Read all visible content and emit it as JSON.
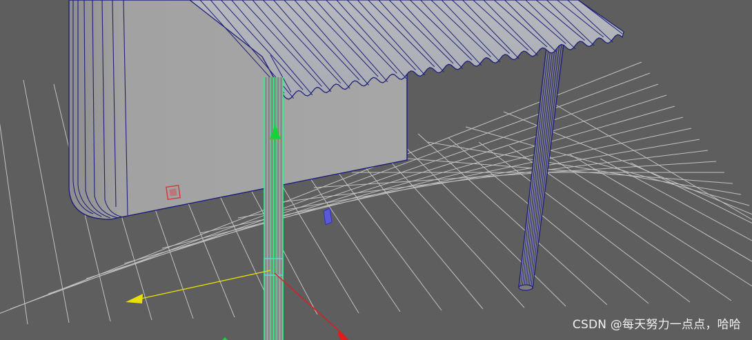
{
  "viewport": {
    "background": "#5e5e5e",
    "grid_color": "#d8d8d8",
    "wire_color": "#1d1f78",
    "selection_color": "#38f58c",
    "axis_x_color": "#e01b1b",
    "axis_y_color": "#18d13b",
    "axis_z_color": "#e8e000"
  },
  "objects": [
    {
      "name": "house-wall",
      "icon": "mesh-icon"
    },
    {
      "name": "corrugated-roof",
      "icon": "mesh-icon"
    },
    {
      "name": "selected-post",
      "icon": "cylinder-icon"
    },
    {
      "name": "back-post",
      "icon": "cylinder-icon"
    }
  ],
  "watermark": {
    "text": "CSDN @每天努力一点点，哈哈"
  }
}
